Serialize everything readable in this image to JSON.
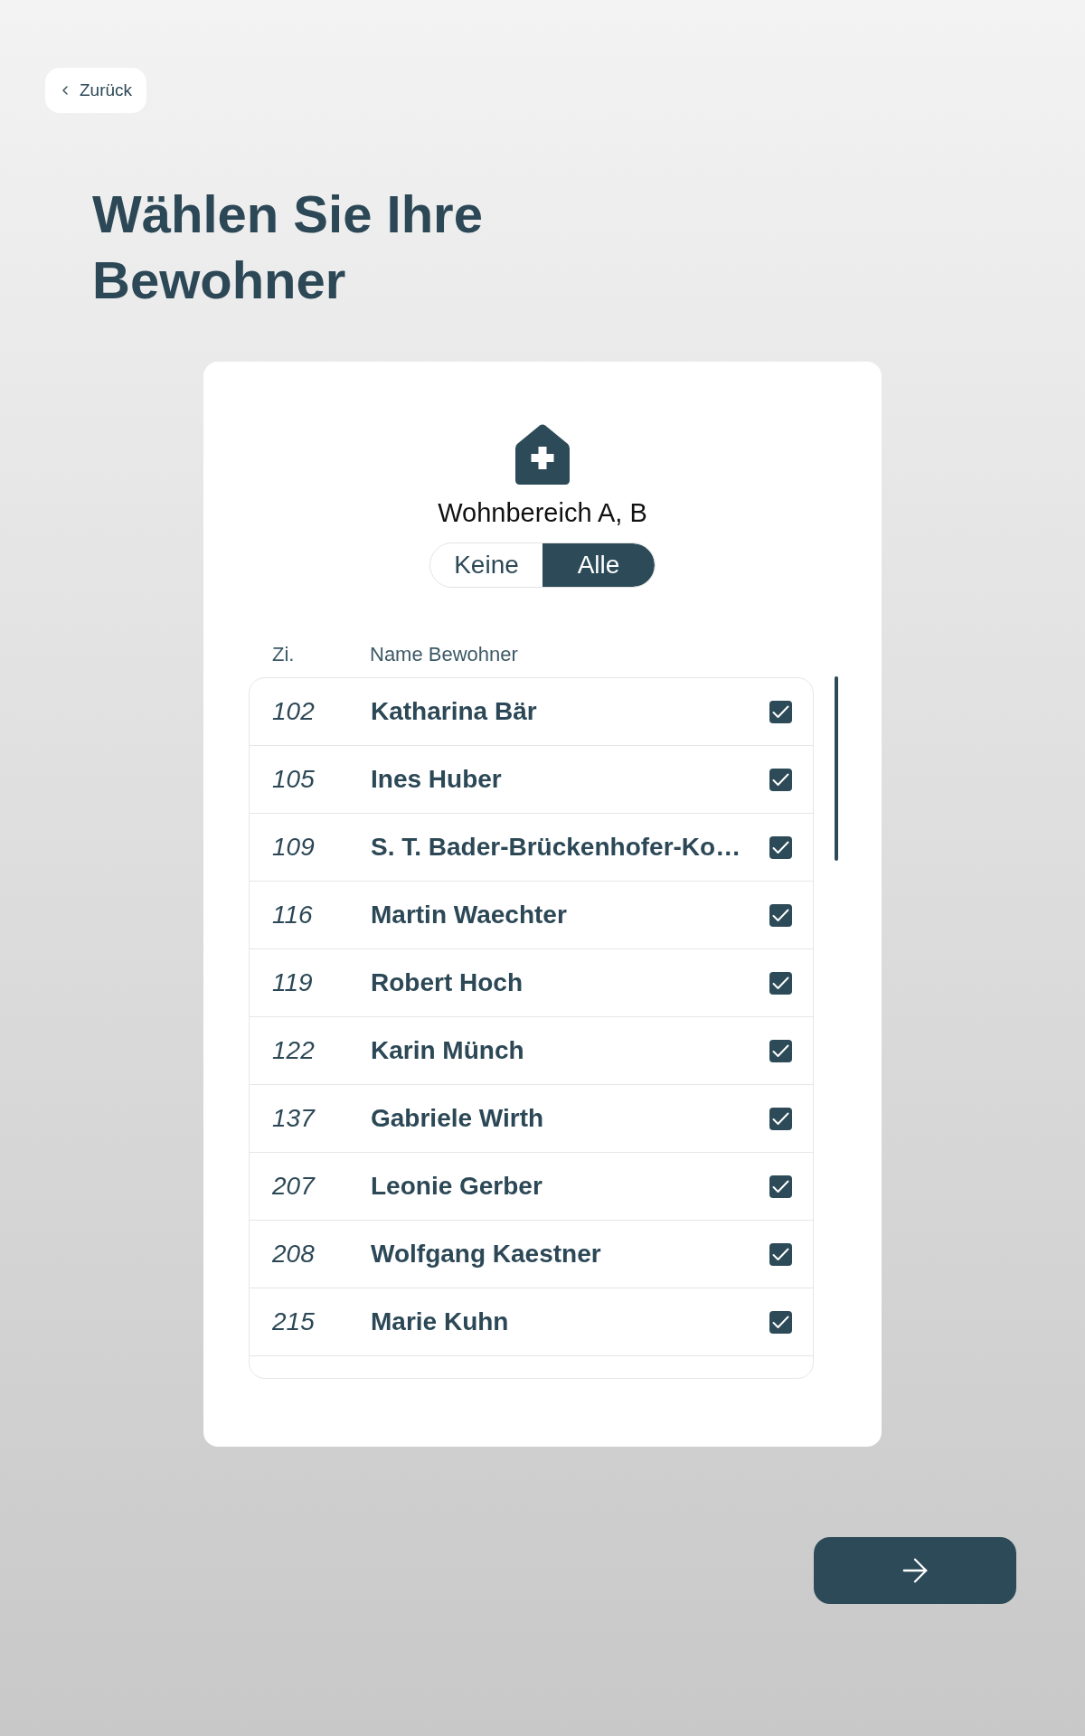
{
  "back_button": {
    "label": "Zurück"
  },
  "title": "Wählen Sie Ihre Bewohner",
  "area": {
    "label": "Wohnbereich A, B"
  },
  "filter": [
    {
      "label": "Keine",
      "selected": false
    },
    {
      "label": "Alle",
      "selected": true
    }
  ],
  "table": {
    "columns": [
      "Zi.",
      "Name Bewohner"
    ],
    "rows": [
      {
        "room": "102",
        "name": "Katharina Bär",
        "checked": true
      },
      {
        "room": "105",
        "name": "Ines Huber",
        "checked": true
      },
      {
        "room": "109",
        "name": "S. T. Bader-Brückenhofer-Ko…",
        "checked": true
      },
      {
        "room": "116",
        "name": "Martin Waechter",
        "checked": true
      },
      {
        "room": "119",
        "name": "Robert Hoch",
        "checked": true
      },
      {
        "room": "122",
        "name": "Karin Münch",
        "checked": true
      },
      {
        "room": "137",
        "name": "Gabriele Wirth",
        "checked": true
      },
      {
        "room": "207",
        "name": "Leonie Gerber",
        "checked": true
      },
      {
        "room": "208",
        "name": "Wolfgang Kaestner",
        "checked": true
      },
      {
        "room": "215",
        "name": "Marie Kuhn",
        "checked": true
      }
    ]
  }
}
